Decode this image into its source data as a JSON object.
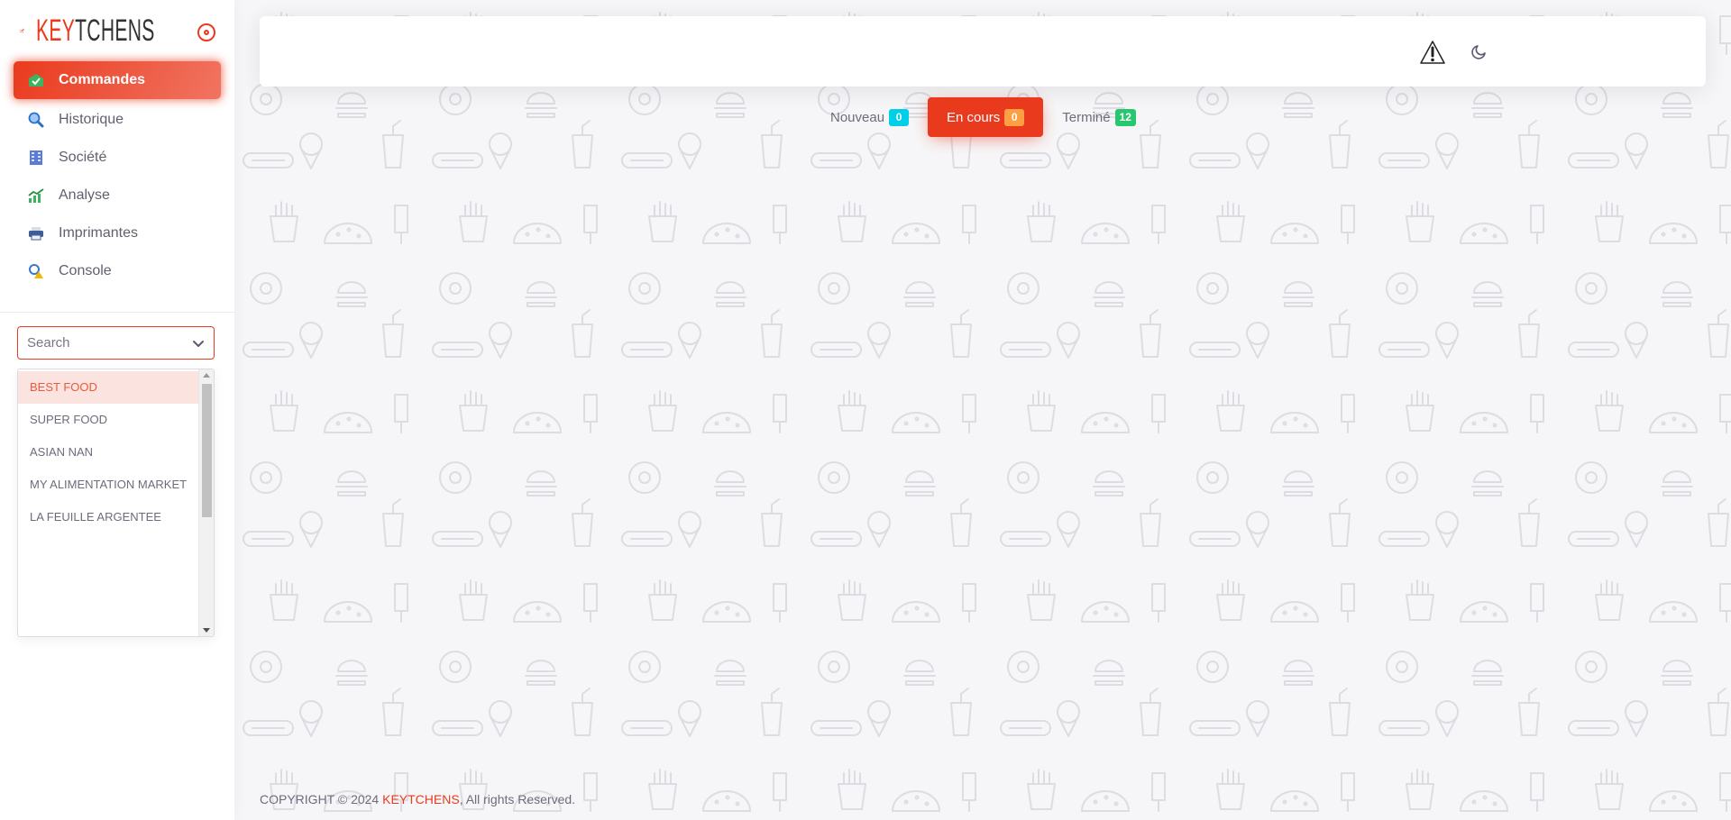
{
  "brand": {
    "name_accent": "KEY",
    "name_rest": "TCHENS",
    "accent_color": "#ea3a1e",
    "logo_icon": "running-man-icon"
  },
  "sidebar": {
    "items": [
      {
        "label": "Commandes",
        "icon": "checkmark-box-icon",
        "active": true
      },
      {
        "label": "Historique",
        "icon": "magnifier-icon",
        "active": false
      },
      {
        "label": "Société",
        "icon": "building-icon",
        "active": false
      },
      {
        "label": "Analyse",
        "icon": "growth-chart-icon",
        "active": false
      },
      {
        "label": "Imprimantes",
        "icon": "printer-icon",
        "active": false
      },
      {
        "label": "Console",
        "icon": "console-warning-icon",
        "active": false
      }
    ],
    "company_select": {
      "placeholder": "Search",
      "value": "",
      "options": [
        {
          "label": "BEST FOOD",
          "highlighted": true
        },
        {
          "label": "SUPER FOOD",
          "highlighted": false
        },
        {
          "label": "ASIAN NAN",
          "highlighted": false
        },
        {
          "label": "MY ALIMENTATION MARKET",
          "highlighted": false
        },
        {
          "label": "LA FEUILLE ARGENTEE",
          "highlighted": false
        }
      ]
    }
  },
  "navbar": {
    "icons": [
      "warning-icon",
      "moon-icon",
      "france-flag-icon"
    ]
  },
  "tabs": [
    {
      "label": "Nouveau",
      "count": "0",
      "badge_color": "#00cfe8",
      "active": false
    },
    {
      "label": "En cours",
      "count": "0",
      "badge_color": "#ff9f43",
      "active": true
    },
    {
      "label": "Terminé",
      "count": "12",
      "badge_color": "#28c76f",
      "active": false
    }
  ],
  "footer": {
    "prefix": "COPYRIGHT © 2024 ",
    "brand": "KEYTCHENS",
    "suffix": ", All rights Reserved."
  }
}
